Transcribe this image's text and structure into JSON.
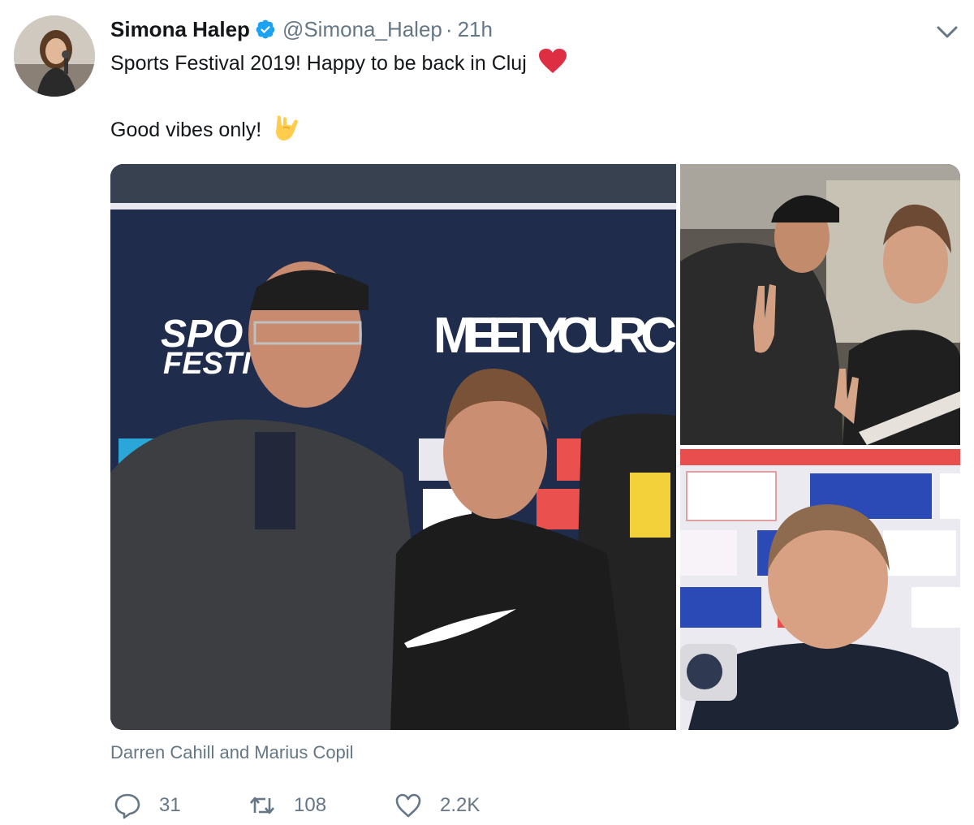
{
  "tweet": {
    "display_name": "Simona Halep",
    "handle": "@Simona_Halep",
    "separator": "·",
    "time": "21h",
    "text_line1": "Sports Festival 2019! Happy to be back in Cluj",
    "text_line2": "Good vibes only!",
    "caption": "Darren Cahill and Marius Copil",
    "replies": "31",
    "retweets": "108",
    "likes": "2.2K"
  },
  "photos": {
    "main_banner_text": "MEET YOUR C",
    "main_logo_text_1": "SPO",
    "main_logo_text_2": "FESTI"
  },
  "colors": {
    "verified": "#1da1f2",
    "heart": "#e0245e",
    "secondary_text": "#657786"
  },
  "icons": [
    "verified-icon",
    "chevron-down-icon",
    "heart-emoji-icon",
    "rock-hand-emoji-icon",
    "reply-icon",
    "retweet-icon",
    "like-icon"
  ]
}
